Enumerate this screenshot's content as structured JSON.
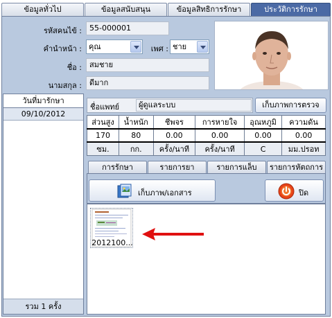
{
  "tabs": [
    "ข้อมูลทั่วไป",
    "ข้อมูลสนับสนุน",
    "ข้อมูลสิทธิการรักษา",
    "ประวัติการรักษา"
  ],
  "patient": {
    "user_code_label": "รหัสคนไข้ :",
    "user_code_value": "55-000001",
    "prefix_label": "คำนำหน้า :",
    "prefix_value": "คุณ",
    "gender_label": "เพศ :",
    "gender_value": "ชาย",
    "first_name_label": "ชื่อ :",
    "first_name_value": "สมชาย",
    "last_name_label": "นามสกุล :",
    "last_name_value": "ดีมาก"
  },
  "visits": {
    "header": "วันที่มารักษา",
    "dates": [
      "09/10/2012"
    ],
    "total": "รวม 1 ครั้ง"
  },
  "doctor": {
    "label": "ชื่อแพทย์",
    "value": "ผู้ดูแลระบบ",
    "save_exam_button": "เก็บภาพการตรวจ"
  },
  "vitals": {
    "headers": [
      "ส่วนสูง",
      "น้ำหนัก",
      "ชีพจร",
      "การหายใจ",
      "อุณหภูมิ",
      "ความดัน"
    ],
    "values": [
      "170",
      "80",
      "0.00",
      "0.00",
      "0.00",
      "0.00"
    ],
    "units": [
      "ซม.",
      "กก.",
      "ครั้ง/นาที",
      "ครั้ง/นาที",
      "C",
      "มม.ปรอท"
    ]
  },
  "subtabs": [
    "การรักษา",
    "รายการยา",
    "รายการแล็บ",
    "รายการหัตถการ"
  ],
  "actions": {
    "save_image_button": "เก็บภาพ/เอกสาร",
    "close_button": "ปิด"
  },
  "thumbnail": {
    "caption": "2012100..."
  },
  "colors": {
    "active_tab": "#4b6aa5",
    "panel_bg": "#b9c9df",
    "arrow": "#e01010"
  }
}
